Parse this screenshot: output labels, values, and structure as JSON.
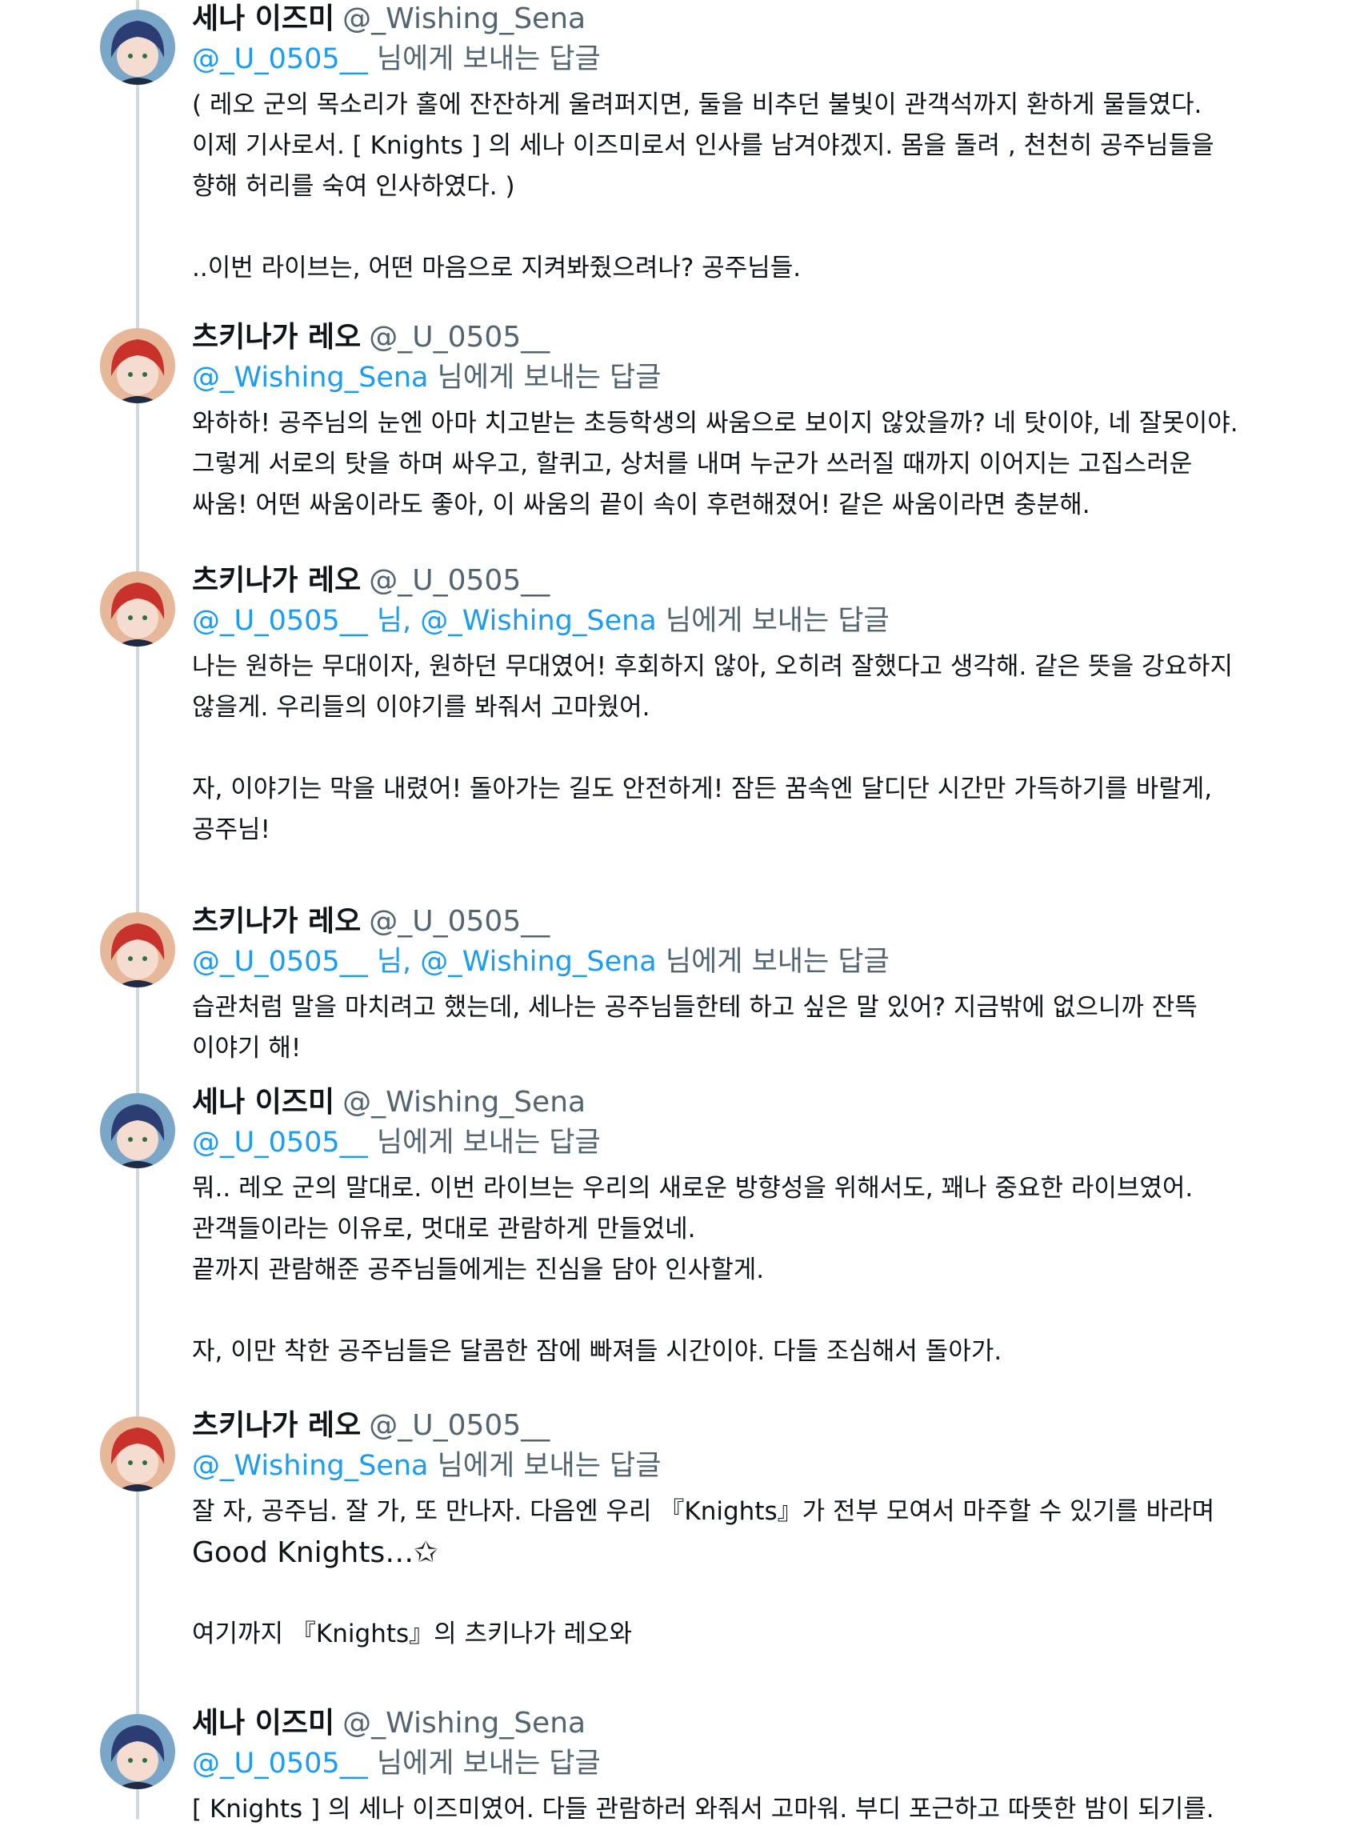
{
  "users": {
    "sena": {
      "name": "세나 이즈미",
      "handle": "@_Wishing_Sena",
      "avatar_icon": "sena-avatar-icon",
      "hair_color": "#2b3d73"
    },
    "leo": {
      "name": "츠키나가 레오",
      "handle": "@_U_0505__",
      "avatar_icon": "leo-avatar-icon",
      "hair_color": "#c8322a"
    }
  },
  "colors": {
    "text": "#0f1419",
    "secondary": "#536471",
    "mention": "#1d9bf0",
    "thread_line": "#cfd9de"
  },
  "thread": [
    {
      "author": "sena",
      "name": "세나 이즈미",
      "handle": "@_Wishing_Sena",
      "reply_mentions": "@_U_0505__",
      "reply_suffix": " 님에게 보내는 답글",
      "lines": [
        "( 레오 군의 목소리가 홀에 잔잔하게 울려퍼지면, 둘을 비추던 불빛이 관객석까지 환하게 물들였다.",
        "이제 기사로서. [ Knights ] 의 세나 이즈미로서 인사를 남겨야겠지. 몸을 돌려 , 천천히 공주님들을",
        "향해 허리를 숙여 인사하였다. )",
        "",
        "..이번 라이브는, 어떤 마음으로 지켜봐줬으려나? 공주님들."
      ]
    },
    {
      "author": "leo",
      "name": "츠키나가 레오",
      "handle": "@_U_0505__",
      "reply_mentions": "@_Wishing_Sena",
      "reply_suffix": " 님에게 보내는 답글",
      "lines": [
        "와하하! 공주님의 눈엔 아마 치고받는 초등학생의 싸움으로 보이지 않았을까? 네 탓이야, 네 잘못이야.",
        "그렇게 서로의 탓을 하며 싸우고, 할퀴고, 상처를 내며 누군가 쓰러질 때까지 이어지는 고집스러운",
        "싸움! 어떤 싸움이라도 좋아, 이 싸움의 끝이 속이 후련해졌어! 같은 싸움이라면 충분해."
      ]
    },
    {
      "author": "leo",
      "name": "츠키나가 레오",
      "handle": "@_U_0505__",
      "reply_mentions": "@_U_0505__ 님, @_Wishing_Sena",
      "reply_suffix": " 님에게 보내는 답글",
      "lines": [
        "나는 원하는 무대이자, 원하던 무대였어! 후회하지 않아, 오히려 잘했다고 생각해. 같은 뜻을 강요하지",
        "않을게. 우리들의 이야기를 봐줘서 고마웠어.",
        "",
        "자, 이야기는 막을 내렸어! 돌아가는 길도 안전하게! 잠든 꿈속엔 달디단 시간만 가득하기를 바랄게,",
        "공주님!"
      ]
    },
    {
      "author": "leo",
      "name": "츠키나가 레오",
      "handle": "@_U_0505__",
      "reply_mentions": "@_U_0505__ 님, @_Wishing_Sena",
      "reply_suffix": " 님에게 보내는 답글",
      "lines": [
        "습관처럼 말을 마치려고 했는데, 세나는 공주님들한테 하고 싶은 말 있어? 지금밖에 없으니까 잔뜩",
        "이야기 해!"
      ]
    },
    {
      "author": "sena",
      "name": "세나 이즈미",
      "handle": "@_Wishing_Sena",
      "reply_mentions": "@_U_0505__",
      "reply_suffix": " 님에게 보내는 답글",
      "lines": [
        "뭐.. 레오 군의 말대로. 이번 라이브는 우리의 새로운 방향성을 위해서도, 꽤나 중요한 라이브였어.",
        "관객들이라는 이유로, 멋대로 관람하게 만들었네.",
        "끝까지 관람해준 공주님들에게는 진심을 담아 인사할게.",
        "",
        "자, 이만 착한 공주님들은 달콤한 잠에 빠져들 시간이야. 다들 조심해서 돌아가."
      ]
    },
    {
      "author": "leo",
      "name": "츠키나가 레오",
      "handle": "@_U_0505__",
      "reply_mentions": "@_Wishing_Sena",
      "reply_suffix": " 님에게 보내는 답글",
      "lines": [
        "잘 자, 공주님. 잘 가,  또 만나자. 다음엔 우리 『Knights』가 전부 모여서 마주할 수 있기를 바라며",
        "Good Knights…✩",
        "",
        "여기까지 『Knights』의 츠키나가 레오와"
      ]
    },
    {
      "author": "sena",
      "name": "세나 이즈미",
      "handle": "@_Wishing_Sena",
      "reply_mentions": "@_U_0505__",
      "reply_suffix": " 님에게 보내는 답글",
      "lines": [
        "[ Knights ] 의 세나 이즈미였어. 다들 관람하러 와줘서 고마워. 부디 포근하고 따뜻한 밤이 되기를."
      ]
    }
  ]
}
